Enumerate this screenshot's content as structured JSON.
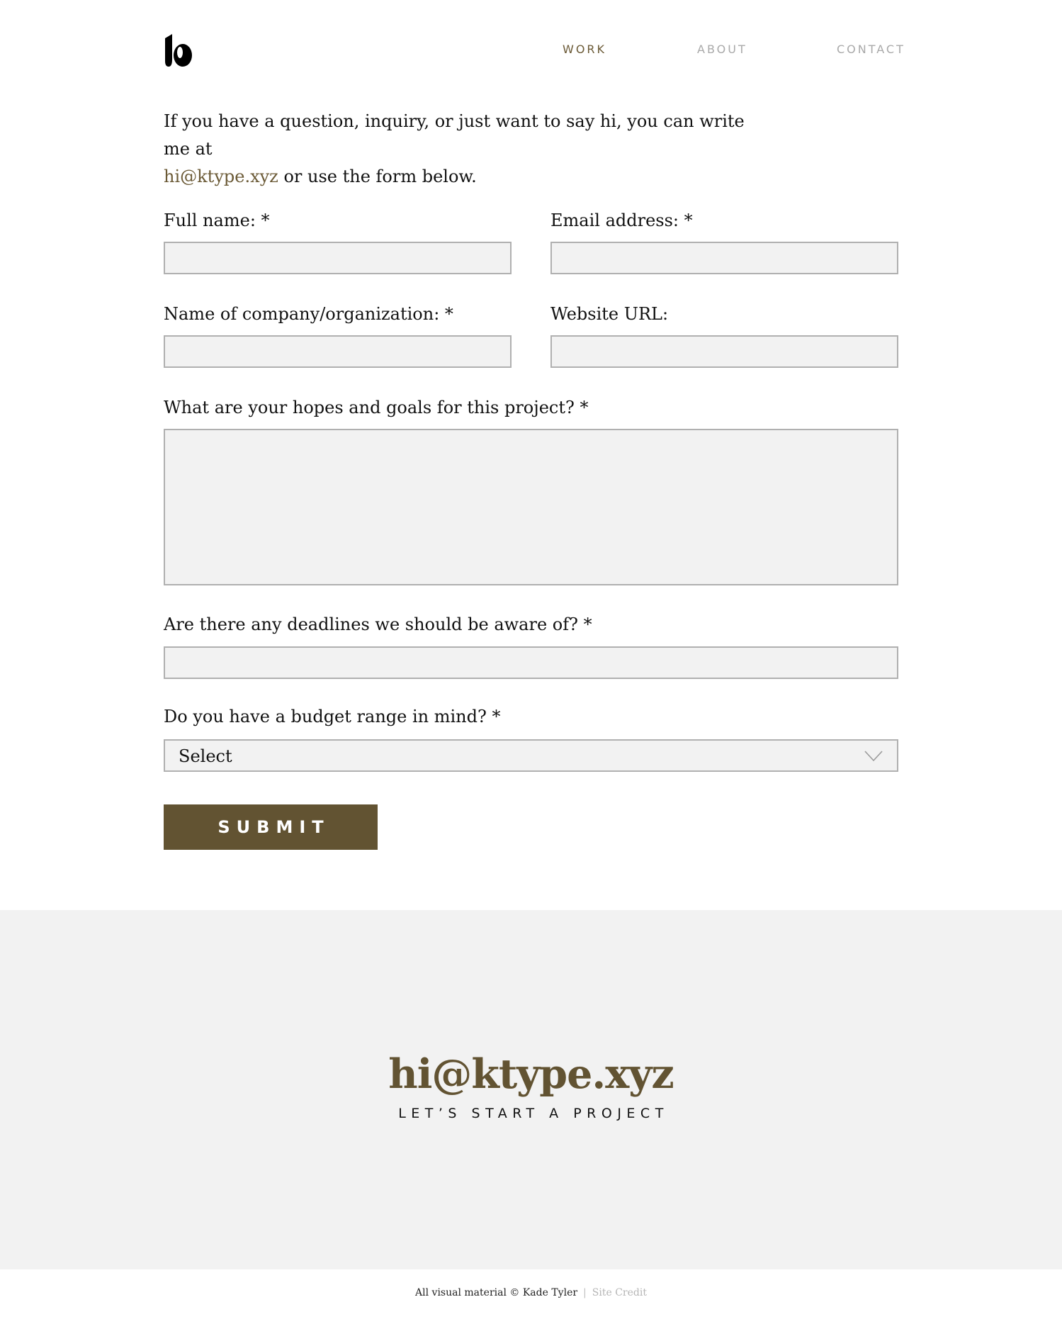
{
  "nav": {
    "work": "WORK",
    "about": "ABOUT",
    "contact": "CONTACT"
  },
  "intro": {
    "text_before": "If you have a question, inquiry, or just want to say hi, you can write me at",
    "email_link": "hi@ktype.xyz",
    "text_after": " or use the form below."
  },
  "form": {
    "full_name_label": "Full name: *",
    "full_name_value": "",
    "email_label": "Email address: *",
    "email_value": "",
    "company_label": "Name of company/organization: *",
    "company_value": "",
    "website_label": "Website URL:",
    "website_value": "",
    "goals_label": "What are your hopes and goals for this project? *",
    "goals_value": "",
    "deadlines_label": "Are there any deadlines we should be aware of? *",
    "deadlines_value": "",
    "budget_label": "Do you have a budget range in mind? *",
    "budget_selected": "Select",
    "submit_label": "SUBMIT"
  },
  "footer": {
    "email": "hi@ktype.xyz",
    "tagline": "LET’S START A PROJECT",
    "copyright": "All visual material © Kade Tyler",
    "separator": "|",
    "site_credit": "Site Credit"
  },
  "colors": {
    "accent": "#625332",
    "link": "#6b5a36",
    "field_bg": "#f2f2f2",
    "field_border": "#b0b0b0",
    "footer_bg": "#f2f2f2"
  },
  "icons": {
    "logo": "ktype-logo",
    "select_arrow": "chevron-down-icon"
  }
}
